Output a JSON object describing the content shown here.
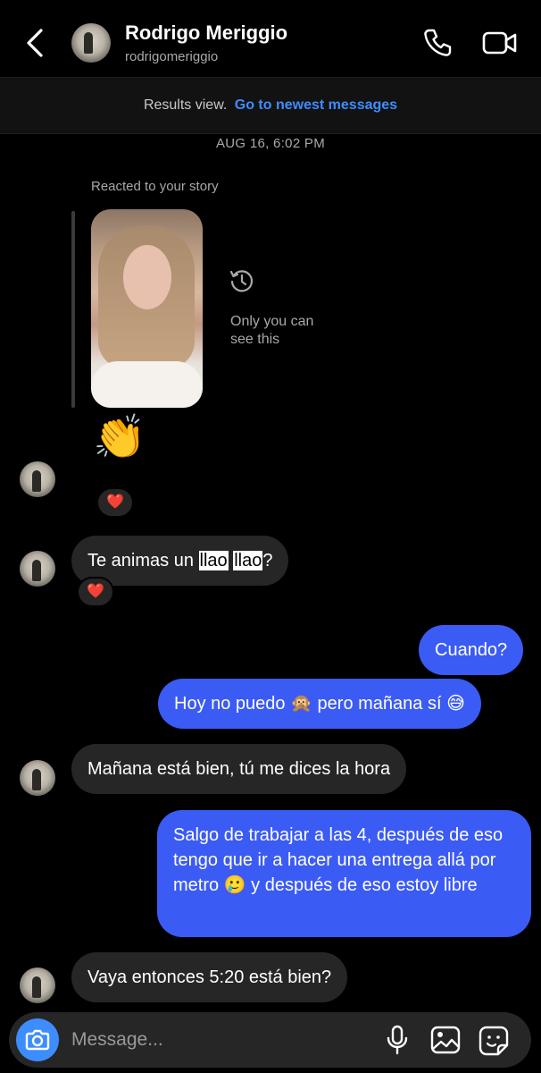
{
  "header": {
    "name": "Rodrigo Meriggio",
    "handle": "rodrigomeriggio"
  },
  "results_bar": {
    "text": "Results view.",
    "link": "Go to newest messages"
  },
  "timestamp": "AUG 16, 6:02 PM",
  "story_reply": {
    "caption": "Reacted to your story",
    "private_note": "Only you can see this",
    "reaction_emoji": "👏",
    "heart": "❤️"
  },
  "messages": {
    "m1": {
      "before": "Te animas un ",
      "hl1": "llao",
      "mid": " ",
      "hl2": "llao",
      "after": "?",
      "reaction": "❤️"
    },
    "m2": "Cuando?",
    "m3": "Hoy no puedo 🙊 pero mañana sí 😅",
    "m4": "Mañana está bien, tú me dices la hora",
    "m5": "Salgo de trabajar a las 4, después de eso tengo que ir a hacer una entrega allá por metro 🥲 y después de eso estoy libre",
    "m6": "Vaya entonces 5:20 está bien?"
  },
  "composer": {
    "placeholder": "Message..."
  },
  "icons": {
    "back": "chevron-left-icon",
    "call": "phone-icon",
    "video": "video-camera-icon",
    "history": "history-icon",
    "camera": "camera-icon",
    "mic": "microphone-icon",
    "gallery": "gallery-icon",
    "sticker": "sticker-icon"
  },
  "colors": {
    "background": "#000000",
    "outgoing_bubble": "#3b5bf5",
    "incoming_bubble": "#262626",
    "link": "#3d8dff"
  }
}
